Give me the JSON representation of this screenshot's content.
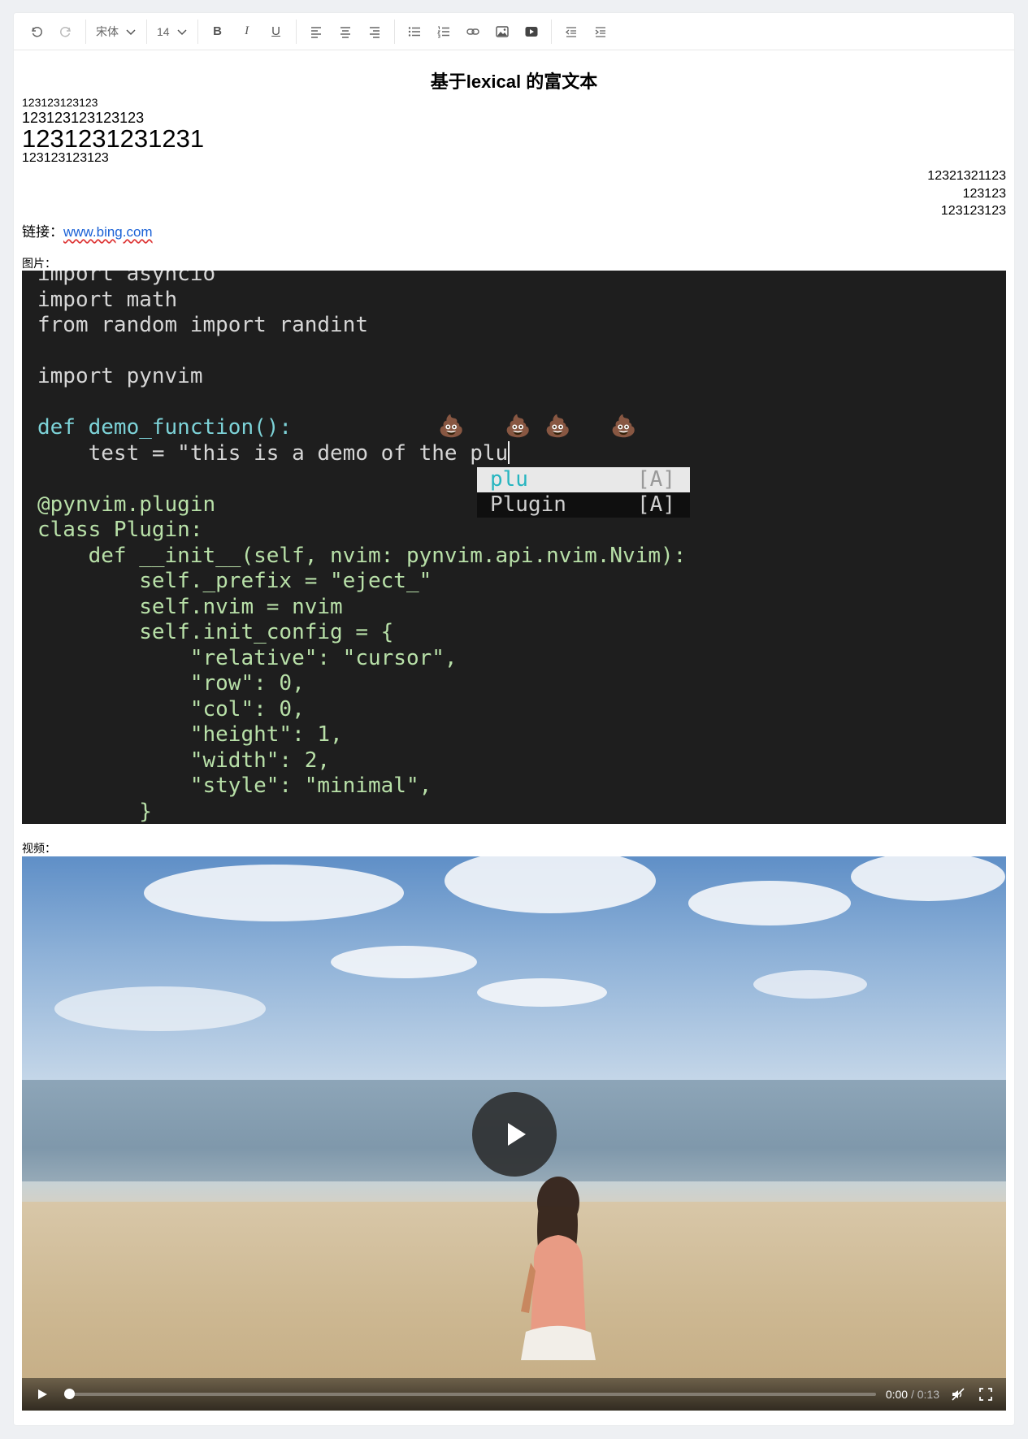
{
  "toolbar": {
    "font_family": "宋体",
    "font_size": "14",
    "bold_label": "B",
    "italic_label": "I",
    "underline_label": "U"
  },
  "document": {
    "title": "基于lexical 的富文本",
    "lines": [
      "123123123123",
      "123123123123123",
      "1231231231231",
      "123123123123"
    ],
    "right_lines": [
      "12321321123",
      "123123",
      "123123123"
    ],
    "link_prefix": "链接：",
    "link_text": "www.bing.com",
    "image_label": "图片：",
    "video_label": "视频："
  },
  "code_image": {
    "lines": [
      "import asyncio",
      "import math",
      "from random import randint",
      "",
      "import pynvim",
      "",
      "def demo_function():",
      "    test = \"this is a demo of the plu",
      "",
      "@pynvim.plugin",
      "class Plugin:",
      "    def __init__(self, nvim: pynvim.api.nvim.Nvim):",
      "        self._prefix = \"eject_\"",
      "        self.nvim = nvim",
      "        self.init_config = {",
      "            \"relative\": \"cursor\",",
      "            \"row\": 0,",
      "            \"col\": 0,",
      "            \"height\": 1,",
      "            \"width\": 2,",
      "            \"style\": \"minimal\",",
      "        }"
    ],
    "completions": [
      {
        "word": "plu",
        "tag": "[A]"
      },
      {
        "word": "Plugin",
        "tag": "[A]"
      }
    ]
  },
  "video": {
    "current_time": "0:00",
    "separator": " / ",
    "duration": "0:13",
    "progress": 0
  },
  "colors": {
    "link": "#1a61d6",
    "code_bg": "#1e1e1e",
    "completion_accent": "#26b5c0"
  }
}
